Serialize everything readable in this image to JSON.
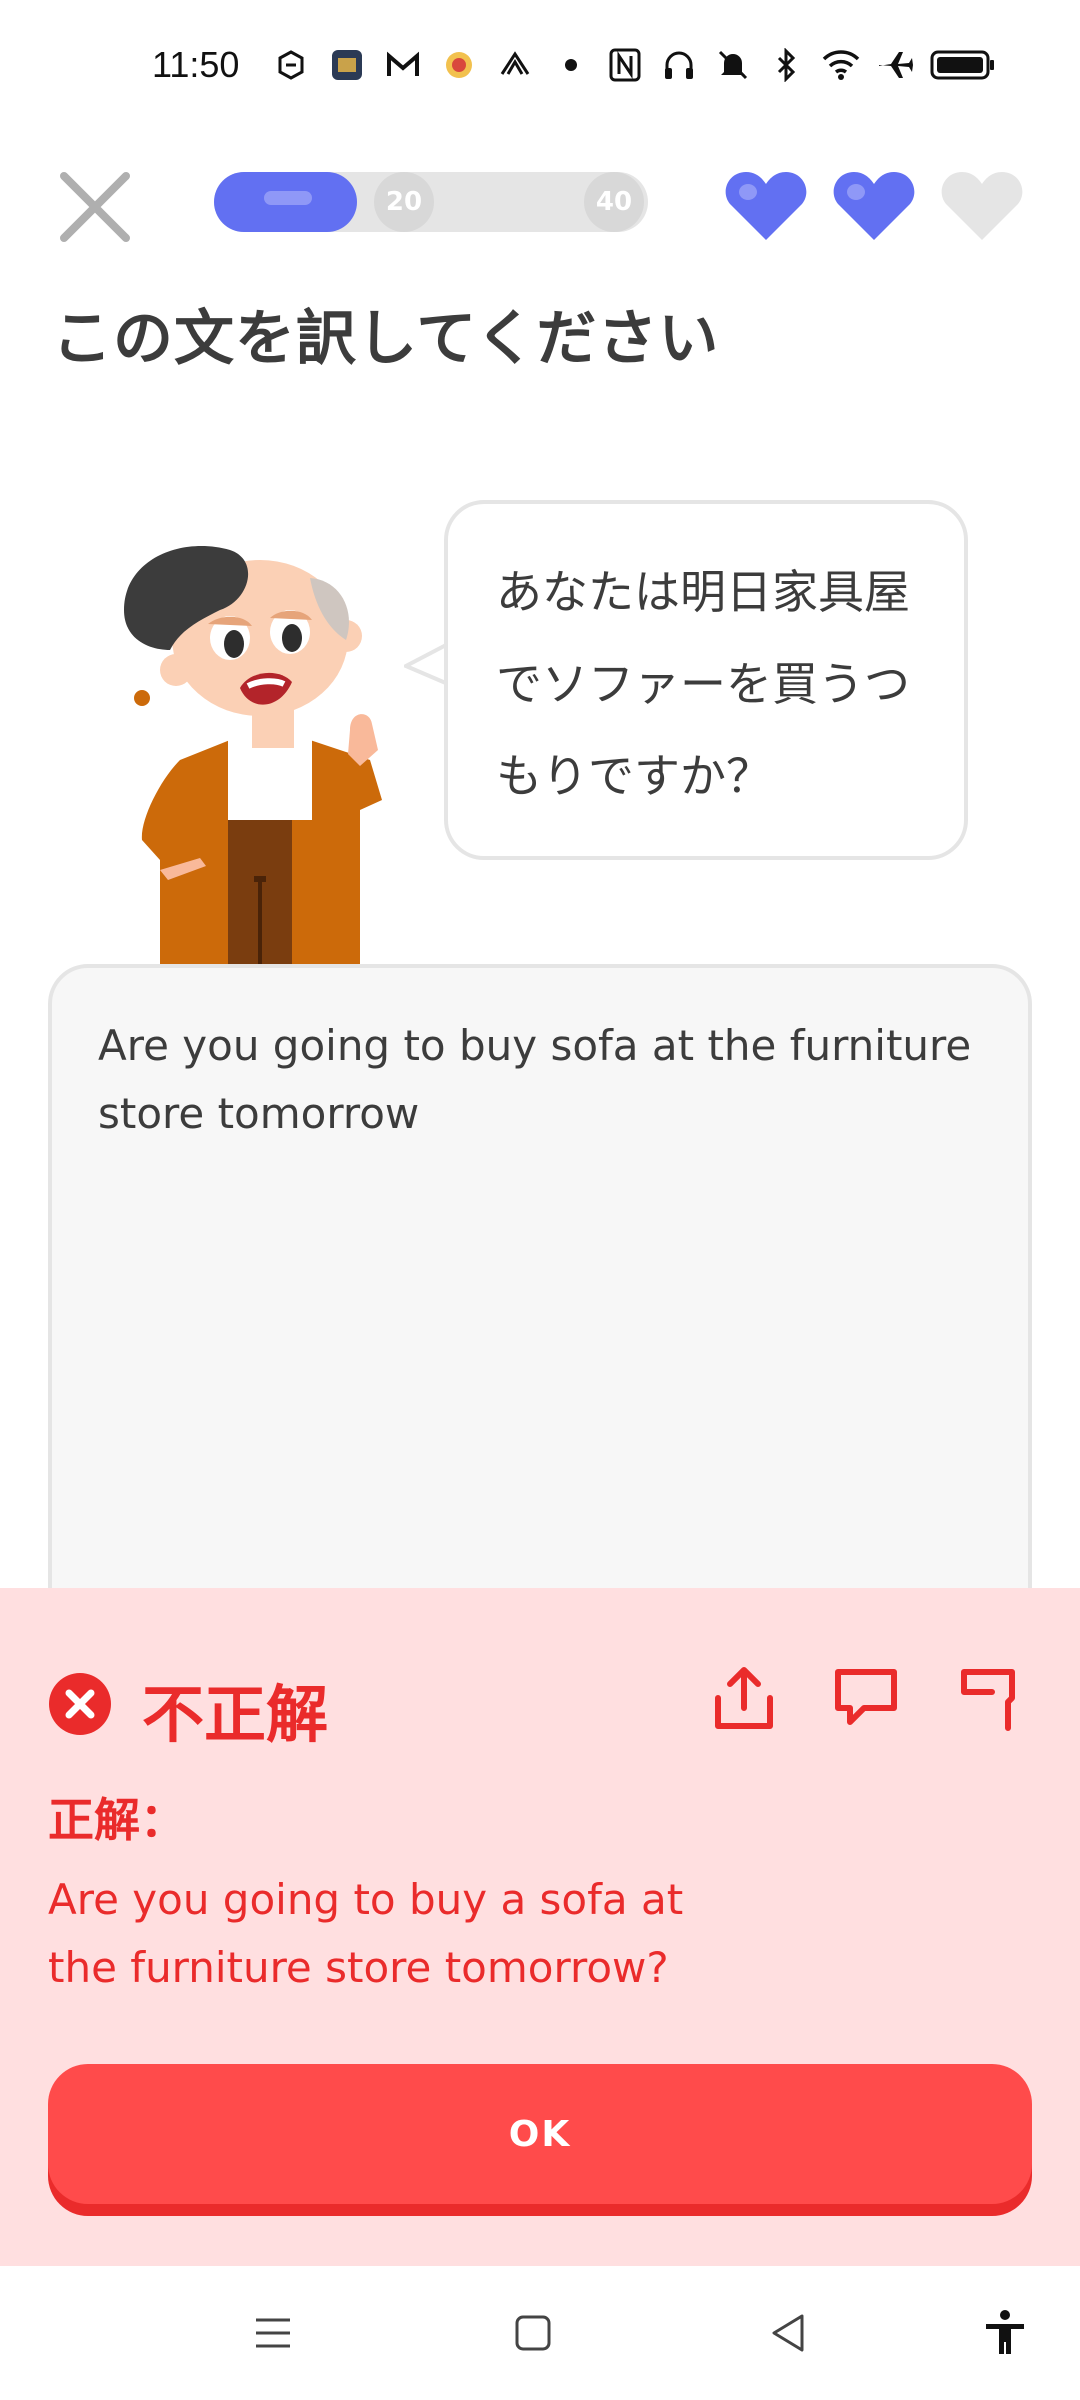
{
  "status_bar": {
    "time": "11:50",
    "left_icons": [
      "sync-icon",
      "app-icon",
      "gmail-icon",
      "app2-icon",
      "app3-icon",
      "dot-icon"
    ],
    "right_icons": [
      "nfc-icon",
      "headphones-icon",
      "mute-icon",
      "bluetooth-icon",
      "wifi-icon",
      "airplane-icon",
      "battery-icon"
    ]
  },
  "top_bar": {
    "progress_fraction": 0.33,
    "milestones": [
      "20",
      "40"
    ],
    "hearts_total": 3,
    "hearts_filled": 2,
    "accent_color": "#6270f2"
  },
  "prompt": {
    "title": "この文を訳してください",
    "sentence": "あなたは明日家具屋でソファーを買うつもりですか？"
  },
  "answer": {
    "text": "Are you going to buy sofa at the furniture store tomorrow"
  },
  "feedback": {
    "title": "不正解",
    "correct_label": "正解：",
    "correct_answer": "Are you going to buy a sofa at the furniture store tomorrow?",
    "ok_label": "OK",
    "color": "#ea2b2b",
    "background": "#ffdfe0"
  },
  "nav_bar": {
    "items": [
      "menu-icon",
      "home-icon",
      "back-icon",
      "accessibility-icon"
    ]
  }
}
